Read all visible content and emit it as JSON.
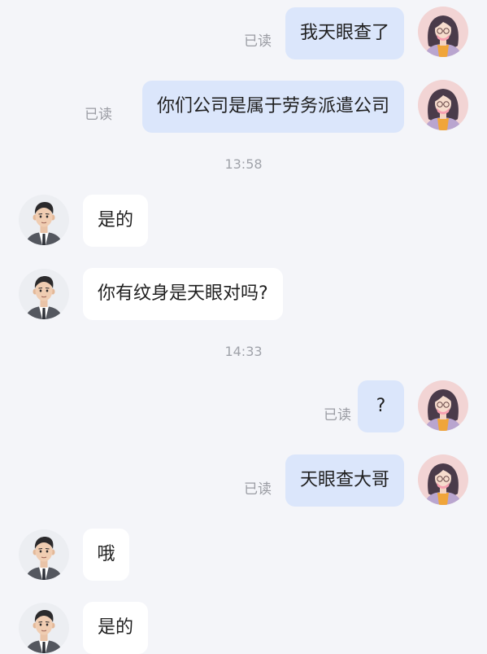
{
  "read_status": "已读",
  "messages": [
    {
      "side": "out",
      "text": "我天眼查了",
      "read": true
    },
    {
      "side": "out",
      "text": "你们公司是属于劳务派遣公司",
      "read": true
    },
    {
      "time": "13:58"
    },
    {
      "side": "in",
      "text": "是的"
    },
    {
      "side": "in",
      "text": "你有纹身是天眼对吗?"
    },
    {
      "time": "14:33"
    },
    {
      "side": "out",
      "text": "?",
      "read": true
    },
    {
      "side": "out",
      "text": "天眼查大哥",
      "read": true
    },
    {
      "side": "in",
      "text": "哦"
    },
    {
      "side": "in",
      "text": "是的"
    }
  ],
  "colors": {
    "background": "#f4f5f9",
    "outgoing_bubble": "#dbe6fb",
    "incoming_bubble": "#ffffff",
    "read_text": "#9a9ca3"
  },
  "icons": {
    "self_avatar": "woman-avatar-icon",
    "other_avatar": "man-avatar-icon"
  }
}
